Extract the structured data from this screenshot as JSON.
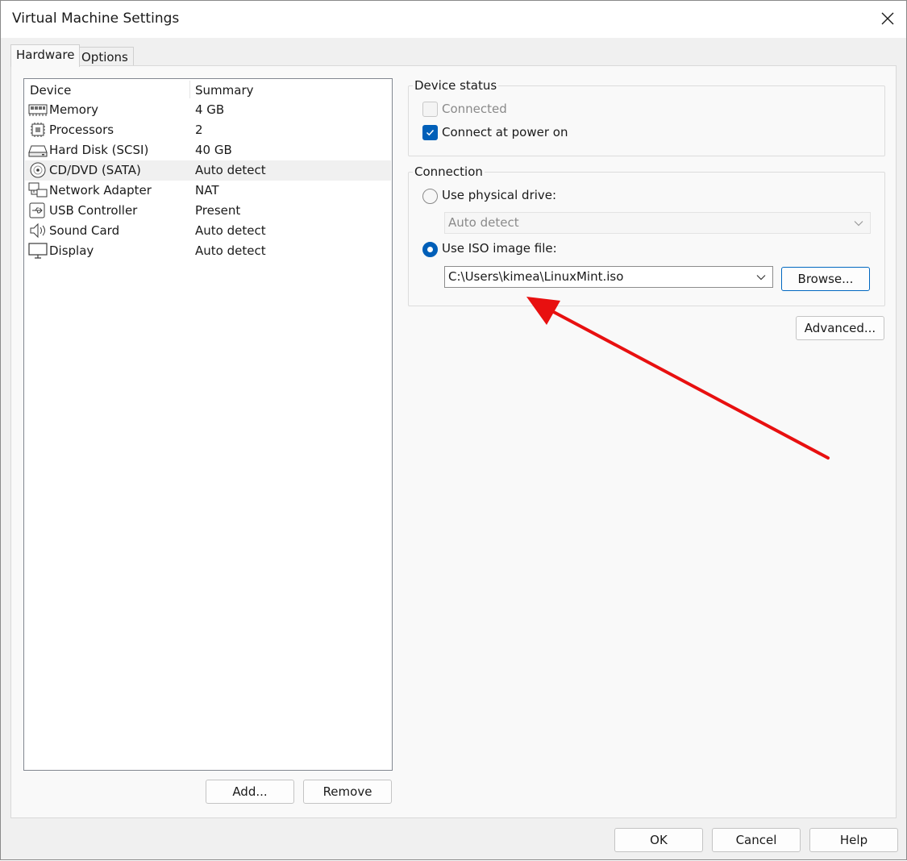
{
  "window": {
    "title": "Virtual Machine Settings"
  },
  "tabs": [
    {
      "label": "Hardware",
      "active": true
    },
    {
      "label": "Options",
      "active": false
    }
  ],
  "device_list": {
    "columns": [
      "Device",
      "Summary"
    ],
    "rows": [
      {
        "icon": "memory-icon",
        "device": "Memory",
        "summary": "4 GB",
        "selected": false
      },
      {
        "icon": "processor-icon",
        "device": "Processors",
        "summary": "2",
        "selected": false
      },
      {
        "icon": "hard-disk-icon",
        "device": "Hard Disk (SCSI)",
        "summary": "40 GB",
        "selected": false
      },
      {
        "icon": "cd-dvd-icon",
        "device": "CD/DVD (SATA)",
        "summary": "Auto detect",
        "selected": true
      },
      {
        "icon": "network-adapter-icon",
        "device": "Network Adapter",
        "summary": "NAT",
        "selected": false
      },
      {
        "icon": "usb-icon",
        "device": "USB Controller",
        "summary": "Present",
        "selected": false
      },
      {
        "icon": "sound-icon",
        "device": "Sound Card",
        "summary": "Auto detect",
        "selected": false
      },
      {
        "icon": "display-icon",
        "device": "Display",
        "summary": "Auto detect",
        "selected": false
      }
    ]
  },
  "list_buttons": {
    "add": "Add...",
    "remove": "Remove"
  },
  "device_status": {
    "title": "Device status",
    "connected": {
      "label": "Connected",
      "checked": false,
      "disabled": true
    },
    "connect_at_power_on": {
      "label": "Connect at power on",
      "checked": true
    }
  },
  "connection": {
    "title": "Connection",
    "physical_drive": {
      "label": "Use physical drive:",
      "selected": false,
      "value": "Auto detect"
    },
    "iso_image": {
      "label": "Use ISO image file:",
      "selected": true,
      "value": "C:\\Users\\kimea\\LinuxMint.iso"
    },
    "browse": "Browse..."
  },
  "advanced": "Advanced...",
  "footer": {
    "ok": "OK",
    "cancel": "Cancel",
    "help": "Help"
  },
  "colors": {
    "accent": "#005fb8",
    "annotation_arrow": "#e81010"
  }
}
